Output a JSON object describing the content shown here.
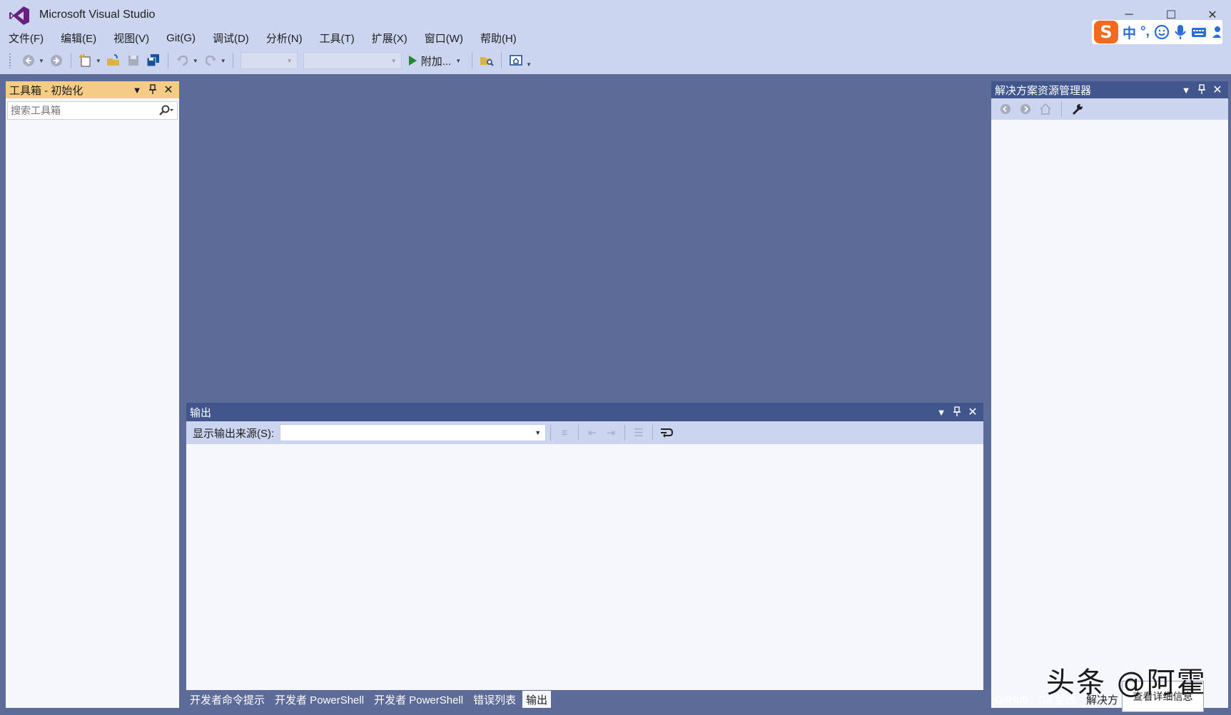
{
  "window": {
    "title": "Microsoft Visual Studio",
    "controls": {
      "minimize": "─",
      "maximize": "☐",
      "close": "✕"
    }
  },
  "ime": {
    "logo": "S",
    "mode": "中",
    "punct": "°,",
    "icons": [
      "emoji-icon",
      "mic-icon",
      "keyboard-icon",
      "user-icon"
    ]
  },
  "menu": [
    "文件(F)",
    "编辑(E)",
    "视图(V)",
    "Git(G)",
    "调试(D)",
    "分析(N)",
    "工具(T)",
    "扩展(X)",
    "窗口(W)",
    "帮助(H)"
  ],
  "toolbar": {
    "start_label": "附加...",
    "icons": [
      "back-icon",
      "forward-icon",
      "new-project-icon",
      "open-file-icon",
      "save-icon",
      "save-all-icon",
      "undo-icon",
      "redo-icon",
      "find-in-files-icon",
      "home-icon"
    ]
  },
  "toolbox": {
    "title": "工具箱 - 初始化",
    "search_placeholder": "搜索工具箱"
  },
  "solution_explorer": {
    "title": "解决方案资源管理器"
  },
  "output": {
    "title": "输出",
    "source_label": "显示输出来源(S):",
    "source_value": ""
  },
  "bottom_tabs": [
    "开发者命令提示",
    "开发者 PowerShell",
    "开发者 PowerShell",
    "错误列表",
    "输出"
  ],
  "bottom_active": "输出",
  "right_tabs": [
    "GitHub",
    "Git 更改",
    "解决方"
  ],
  "tooltip": "查看详细信息",
  "watermark": "头条 @阿霍",
  "colors": {
    "chrome": "#ccd5f0",
    "background": "#5d6b98",
    "active_header": "#f5cc84",
    "inactive_header": "#40568d"
  }
}
